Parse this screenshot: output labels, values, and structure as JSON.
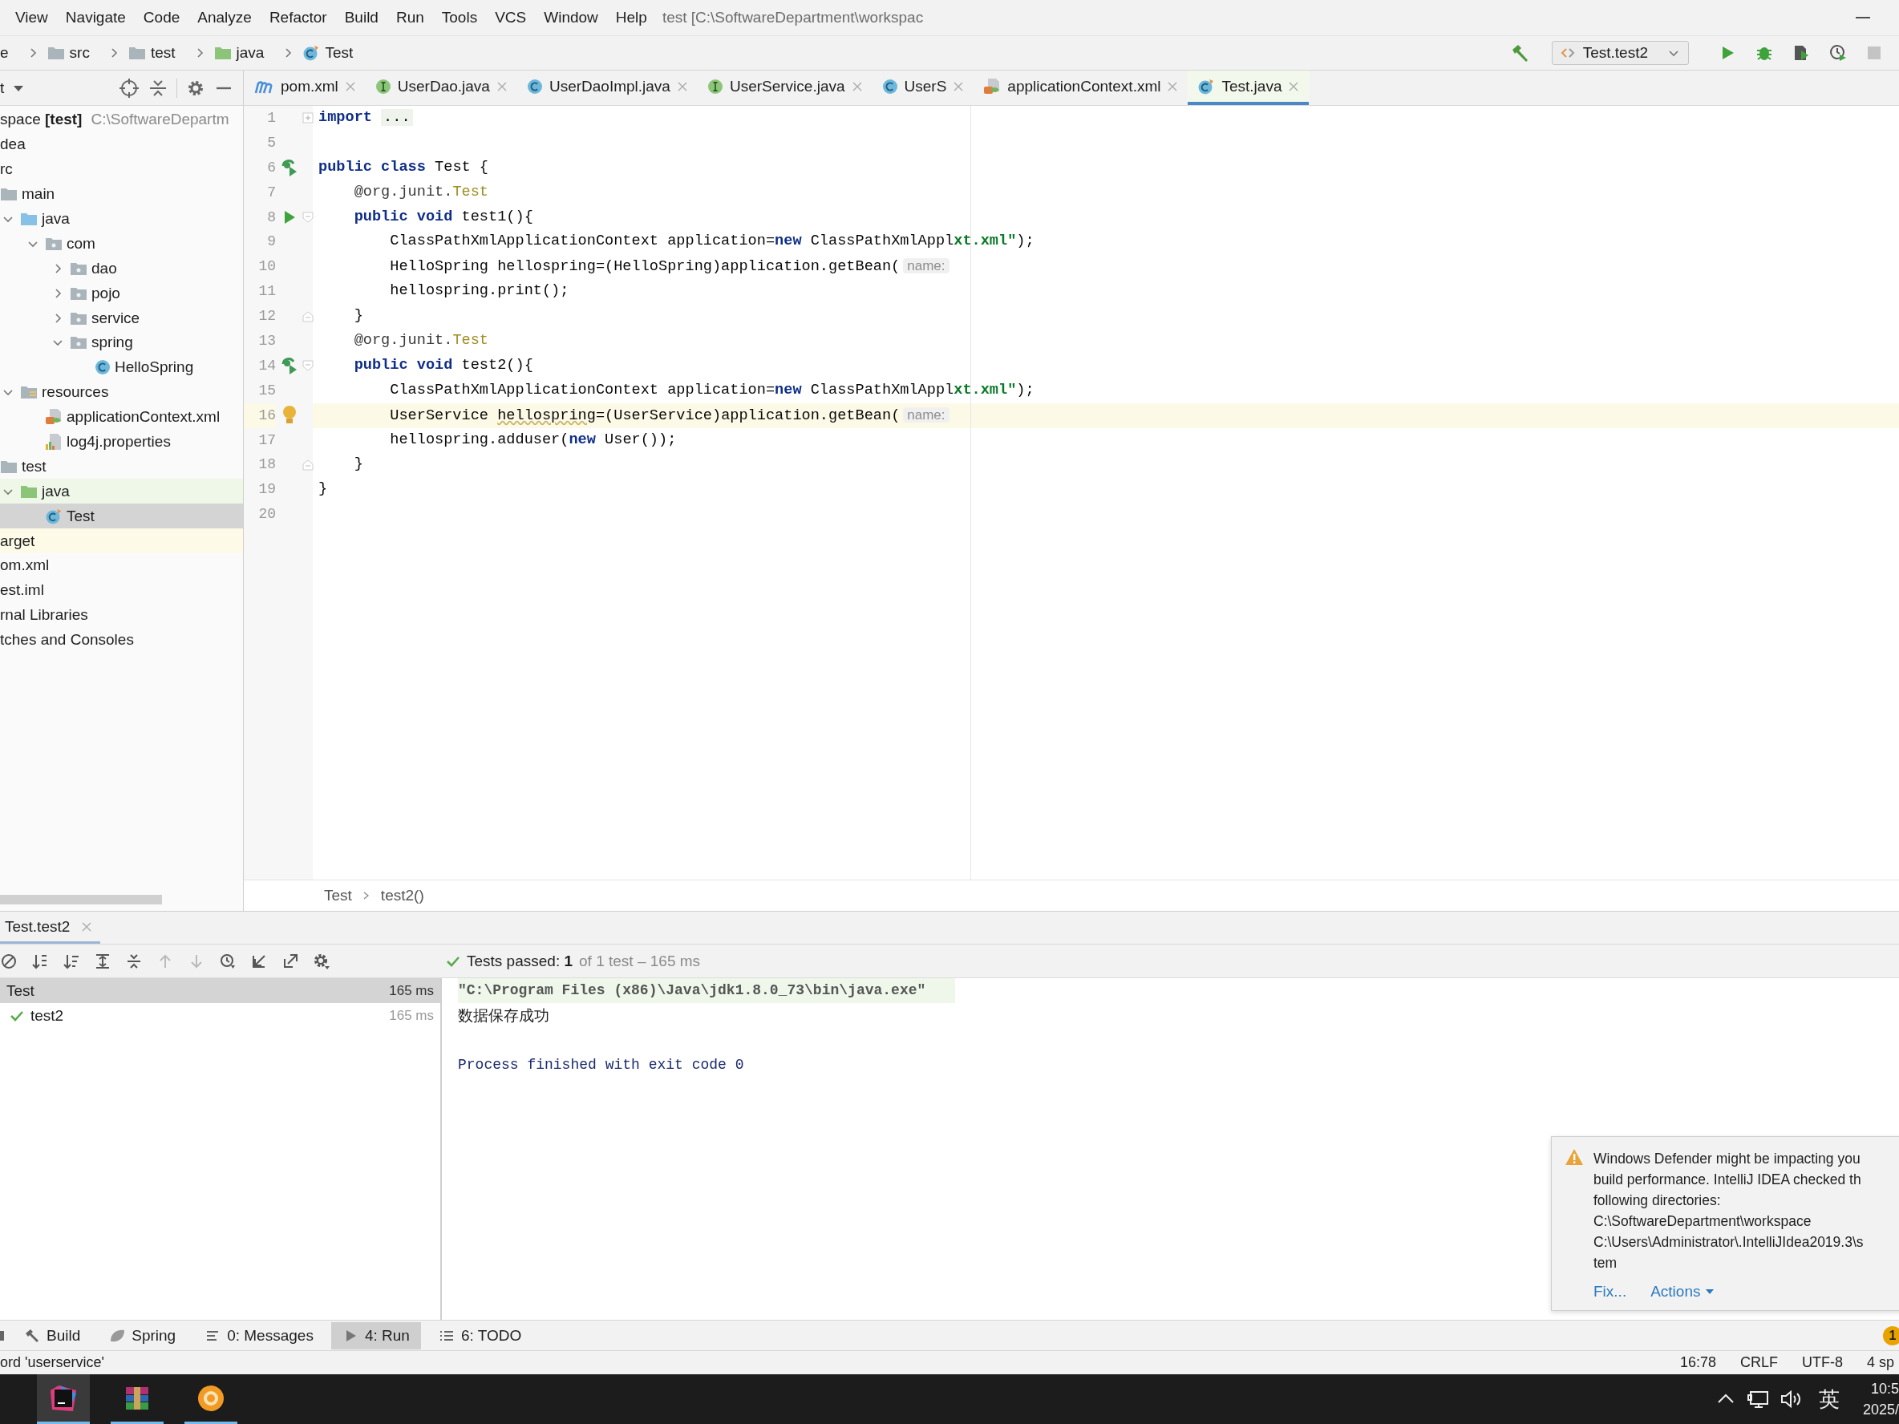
{
  "window": {
    "title": "test [C:\\SoftwareDepartment\\workspac"
  },
  "menu": [
    "View",
    "Navigate",
    "Code",
    "Analyze",
    "Refactor",
    "Build",
    "Run",
    "Tools",
    "VCS",
    "Window",
    "Help"
  ],
  "breadcrumbs": [
    {
      "label": "e"
    },
    {
      "label": "src",
      "kind": "folder"
    },
    {
      "label": "test",
      "kind": "folder"
    },
    {
      "label": "java",
      "kind": "test-folder"
    },
    {
      "label": "Test",
      "kind": "test-class"
    }
  ],
  "run_config": {
    "label": "Test.test2"
  },
  "project_panel": {
    "title": "t",
    "tree": [
      {
        "label": "space **[test]**",
        "path": "C:\\SoftwareDepartm",
        "selected": false,
        "children": [
          {
            "label": "dea",
            "selected": false
          },
          {
            "label": "rc",
            "selected": false,
            "children": [
              {
                "label": "main",
                "kind": "folder",
                "selected": false,
                "children": [
                  {
                    "label": "java",
                    "kind": "source-folder",
                    "expanded": true,
                    "selected": false,
                    "children": [
                      {
                        "label": "com",
                        "kind": "package",
                        "expanded": true,
                        "selected": false,
                        "children": [
                          {
                            "label": "dao",
                            "kind": "package",
                            "expanded": false,
                            "selected": false
                          },
                          {
                            "label": "pojo",
                            "kind": "package",
                            "expanded": false,
                            "selected": false
                          },
                          {
                            "label": "service",
                            "kind": "package",
                            "expanded": false,
                            "selected": false
                          },
                          {
                            "label": "spring",
                            "kind": "package",
                            "expanded": true,
                            "selected": false,
                            "children": [
                              {
                                "label": "HelloSpring",
                                "kind": "class",
                                "selected": false
                              }
                            ]
                          }
                        ]
                      }
                    ]
                  },
                  {
                    "label": "resources",
                    "kind": "resources-folder",
                    "expanded": true,
                    "selected": false,
                    "children": [
                      {
                        "label": "applicationContext.xml",
                        "kind": "xml",
                        "selected": false
                      },
                      {
                        "label": "log4j.properties",
                        "kind": "properties",
                        "selected": false
                      }
                    ]
                  }
                ]
              },
              {
                "label": "test",
                "kind": "folder",
                "selected": false,
                "children": [
                  {
                    "label": "java",
                    "kind": "test-folder",
                    "expanded": true,
                    "selected": false,
                    "color": "#eff8e8",
                    "children": [
                      {
                        "label": "Test",
                        "kind": "test-class",
                        "selected": true
                      }
                    ]
                  }
                ]
              }
            ]
          },
          {
            "label": "arget",
            "selected": false,
            "color": "#fdfbe8"
          },
          {
            "label": "om.xml",
            "selected": false
          },
          {
            "label": "est.iml",
            "selected": false
          }
        ]
      },
      {
        "label": "rnal Libraries",
        "selected": false
      },
      {
        "label": "tches and Consoles",
        "selected": false
      }
    ]
  },
  "editor": {
    "tabs": [
      {
        "label": "pom.xml",
        "kind": "maven",
        "selected": false
      },
      {
        "label": "UserDao.java",
        "kind": "interface",
        "selected": false
      },
      {
        "label": "UserDaoImpl.java",
        "kind": "class",
        "selected": false
      },
      {
        "label": "UserService.java",
        "kind": "interface",
        "selected": false
      },
      {
        "label": "UserS",
        "kind": "class",
        "selected": false
      },
      {
        "label": "applicationContext.xml",
        "kind": "xml",
        "selected": false
      },
      {
        "label": "Test.java",
        "kind": "test-class",
        "selected": true
      }
    ],
    "lines": [
      {
        "number": "1",
        "fold": {
          "kind": "collapsed"
        },
        "current": false,
        "tokens": [
          {
            "kind": "keyword",
            "text": "import"
          },
          {
            "kind": "folded",
            "text": "..."
          }
        ]
      },
      {
        "number": "5",
        "current": false
      },
      {
        "number": "6",
        "gutter": {
          "kind": "run-tests"
        },
        "current": false,
        "tokens": [
          {
            "kind": "keyword",
            "text": "public class"
          },
          {
            "kind": "plain",
            "text": " Test {"
          }
        ]
      },
      {
        "number": "7",
        "current": false,
        "tokens": [
          {
            "kind": "annotation",
            "text": "    @org.junit."
          },
          {
            "kind": "annotation-type",
            "text": "Test"
          }
        ]
      },
      {
        "number": "8",
        "gutter": {
          "kind": "run"
        },
        "fold": {
          "kind": "open"
        },
        "current": false,
        "tokens": [
          {
            "kind": "keyword",
            "text": "    public void"
          },
          {
            "kind": "plain",
            "text": " test1(){"
          }
        ]
      },
      {
        "number": "9",
        "current": false,
        "tokens": [
          {
            "kind": "plain",
            "text": "        ClassPathXmlApplicationContext application="
          },
          {
            "kind": "keyword",
            "text": "new"
          },
          {
            "kind": "plain",
            "text": " ClassPathXmlAppl"
          },
          {
            "kind": "string",
            "text": "xt.xml\""
          },
          {
            "kind": "plain",
            "text": ");"
          }
        ]
      },
      {
        "number": "10",
        "current": false,
        "tokens": [
          {
            "kind": "plain",
            "text": "        HelloSpring hellospring=(HelloSpring)application.getBean("
          },
          {
            "kind": "hint",
            "text": "name:"
          }
        ]
      },
      {
        "number": "11",
        "current": false,
        "tokens": [
          {
            "kind": "plain",
            "text": "        hellospring.print();"
          }
        ]
      },
      {
        "number": "12",
        "fold": {
          "kind": "close"
        },
        "current": false,
        "tokens": [
          {
            "kind": "plain",
            "text": "    }"
          }
        ]
      },
      {
        "number": "13",
        "current": false,
        "tokens": [
          {
            "kind": "annotation",
            "text": "    @org.junit."
          },
          {
            "kind": "annotation-type",
            "text": "Test"
          }
        ]
      },
      {
        "number": "14",
        "gutter": {
          "kind": "run-tests"
        },
        "fold": {
          "kind": "open"
        },
        "current": false,
        "tokens": [
          {
            "kind": "keyword",
            "text": "    public void"
          },
          {
            "kind": "plain",
            "text": " test2(){"
          }
        ]
      },
      {
        "number": "15",
        "current": false,
        "tokens": [
          {
            "kind": "plain",
            "text": "        ClassPathXmlApplicationContext application="
          },
          {
            "kind": "keyword",
            "text": "new"
          },
          {
            "kind": "plain",
            "text": " ClassPathXmlAppl"
          },
          {
            "kind": "string",
            "text": "xt.xml\""
          },
          {
            "kind": "plain",
            "text": ");"
          }
        ]
      },
      {
        "number": "16",
        "gutter": {
          "kind": "bulb"
        },
        "current": true,
        "tokens": [
          {
            "kind": "plain",
            "text": "        UserService "
          },
          {
            "kind": "warning",
            "text": "hellospring"
          },
          {
            "kind": "plain",
            "text": "=(UserService)application.getBean("
          },
          {
            "kind": "hint",
            "text": "name:"
          }
        ]
      },
      {
        "number": "17",
        "current": false,
        "tokens": [
          {
            "kind": "plain",
            "text": "        hellospring.adduser("
          },
          {
            "kind": "keyword",
            "text": "new"
          },
          {
            "kind": "plain",
            "text": " User());"
          }
        ]
      },
      {
        "number": "18",
        "fold": {
          "kind": "close"
        },
        "current": false,
        "tokens": [
          {
            "kind": "plain",
            "text": "    }"
          }
        ]
      },
      {
        "number": "19",
        "current": false,
        "tokens": [
          {
            "kind": "plain",
            "text": "}"
          }
        ]
      },
      {
        "number": "20",
        "current": false
      }
    ],
    "breadcrumb": [
      "Test",
      "test2()"
    ]
  },
  "run_panel": {
    "tab": {
      "label": "Test.test2",
      "selected": true
    },
    "status": "Tests passed: **1**",
    "status_detail": "of 1 test – 165 ms",
    "tests": [
      {
        "name": "Test",
        "time": "165 ms",
        "selected": true
      },
      {
        "name": "test2",
        "time": "165 ms",
        "passed": true,
        "selected": false
      }
    ],
    "console": [
      {
        "kind": "command",
        "text": "\"C:\\Program Files (x86)\\Java\\jdk1.8.0_73\\bin\\java.exe\""
      },
      {
        "kind": "output",
        "text": "数据保存成功"
      },
      {
        "kind": "exit",
        "text": "Process finished with exit code 0"
      }
    ]
  },
  "notification": {
    "lines": [
      "Windows Defender might be impacting you",
      "build performance. IntelliJ IDEA checked th",
      "following directories:",
      "C:\\SoftwareDepartment\\workspace",
      "C:\\Users\\Administrator\\.IntelliJIdea2019.3\\s",
      "tem"
    ],
    "actions": [
      {
        "label": "Fix...",
        "dropdown": false
      },
      {
        "label": "Actions",
        "dropdown": true
      }
    ]
  },
  "tool_strip": [
    {
      "label": "Build",
      "kind": "build",
      "selected": false
    },
    {
      "label": "Spring",
      "kind": "spring",
      "selected": false
    },
    {
      "label": "0: Messages",
      "kind": "messages",
      "selected": false
    },
    {
      "label": "4: Run",
      "kind": "run",
      "selected": true
    },
    {
      "label": "6: TODO",
      "kind": "todo",
      "selected": false
    }
  ],
  "event_badge": "1",
  "status_bar": {
    "message": "ord 'userservice'",
    "items": [
      "16:78",
      "CRLF",
      "UTF-8",
      "4 sp"
    ]
  },
  "taskbar": {
    "apps": [
      {
        "kind": "intellij",
        "active": true
      },
      {
        "kind": "archive",
        "active": false
      },
      {
        "kind": "orange-app",
        "active": false
      }
    ],
    "ime": "英",
    "time": "10:5",
    "date": "2025/"
  }
}
